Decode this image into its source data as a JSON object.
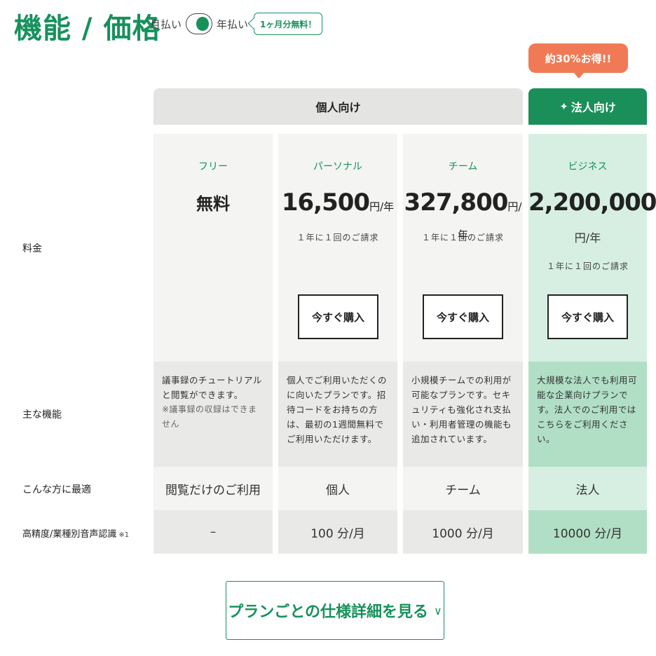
{
  "header": {
    "title": "機能 / 価格",
    "monthly_label": "月払い",
    "yearly_label": "年払い",
    "free_month_badge": "1ヶ月分無料！"
  },
  "deal_badge": "約30%お得!!",
  "groups": {
    "personal": "個人向け",
    "business": "法人向け",
    "business_icon": "sparkle-icon"
  },
  "row_labels": {
    "price": "料金",
    "features": "主な機能",
    "ideal_for": "こんな方に最適",
    "asr": "高精度/業種別音声認識",
    "asr_note": "※1"
  },
  "plans": [
    {
      "name": "フリー",
      "price": "無料",
      "features": "議事録のチュートリアルと閲覧ができます。",
      "features_note": "※議事録の収録はできません",
      "ideal_for": "閲覧だけのご利用",
      "asr": "–"
    },
    {
      "name": "パーソナル",
      "price": "16,500",
      "unit": "円/年",
      "billing": "１年に１回のご請求",
      "buy_label": "今すぐ購入",
      "features": "個人でご利用いただくのに向いたプランです。招待コードをお持ちの方は、最初の1週間無料でご利用いただけます。",
      "ideal_for": "個人",
      "asr": "100 分/月"
    },
    {
      "name": "チーム",
      "price": "327,800",
      "unit": "円/年",
      "billing": "１年に１回のご請求",
      "buy_label": "今すぐ購入",
      "features": "小規模チームでの利用が可能なプランです。セキュリティも強化され支払い・利用者管理の機能も追加されています。",
      "ideal_for": "チーム",
      "asr": "1000 分/月"
    },
    {
      "name": "ビジネス",
      "price": "2,200,000",
      "unit": "円/年",
      "billing": "１年に１回のご請求",
      "buy_label": "今すぐ購入",
      "features": "大規模な法人でも利用可能な企業向けプランです。法人でのご利用ではこちらをご利用ください。",
      "ideal_for": "法人",
      "asr": "10000 分/月"
    }
  ],
  "details_button": "プランごとの仕様詳細を見る",
  "details_icon": "chevron-down-icon",
  "colors": {
    "brand_green": "#17915c",
    "deal_orange": "#f07a55",
    "business_header": "#1a8f5a"
  }
}
